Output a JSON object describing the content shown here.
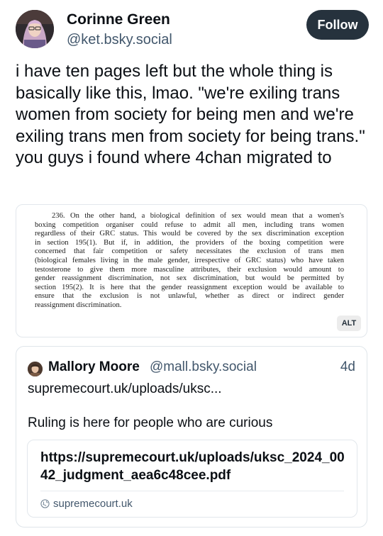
{
  "post": {
    "author": {
      "display_name": "Corinne Green",
      "handle": "@ket.bsky.social"
    },
    "follow_label": "Follow",
    "text": "i have ten pages left but the whole thing is basically like this, lmao. \"we're exiling trans women from society for being men and we're exiling trans men from society for being trans.\" you guys i found where 4chan migrated to",
    "image": {
      "alt_badge": "ALT",
      "document_lines": [
        "236.   On the other hand, a biological definition of sex would mean that a women's",
        "boxing competition organiser could refuse to admit all men, including trans women",
        "regardless of their GRC status. This would be covered by the sex discrimination exception",
        "in section 195(1). But if, in addition, the providers of the boxing competition were",
        "concerned that fair competition or safety necessitates the exclusion of trans men",
        "(biological females living in the male gender, irrespective of GRC status) who have taken",
        "testosterone to give them more masculine attributes, their exclusion would amount to",
        "gender reassignment discrimination, not sex discrimination, but would be permitted by",
        "section 195(2). It is here that the gender reassignment exception would be available to",
        "ensure that the exclusion is not unlawful, whether as direct or indirect gender",
        "reassignment discrimination."
      ]
    }
  },
  "quote": {
    "author": {
      "display_name": "Mallory Moore",
      "handle": "@mall.bsky.social"
    },
    "time": "4d",
    "link_text": "supremecourt.uk/uploads/uksc...",
    "text": "Ruling is here for people who are curious",
    "link_card": {
      "title": "https://supremecourt.uk/uploads/uksc_2024_0042_judgment_aea6c48cee.pdf",
      "domain": "supremecourt.uk",
      "icon": "globe-icon"
    }
  }
}
